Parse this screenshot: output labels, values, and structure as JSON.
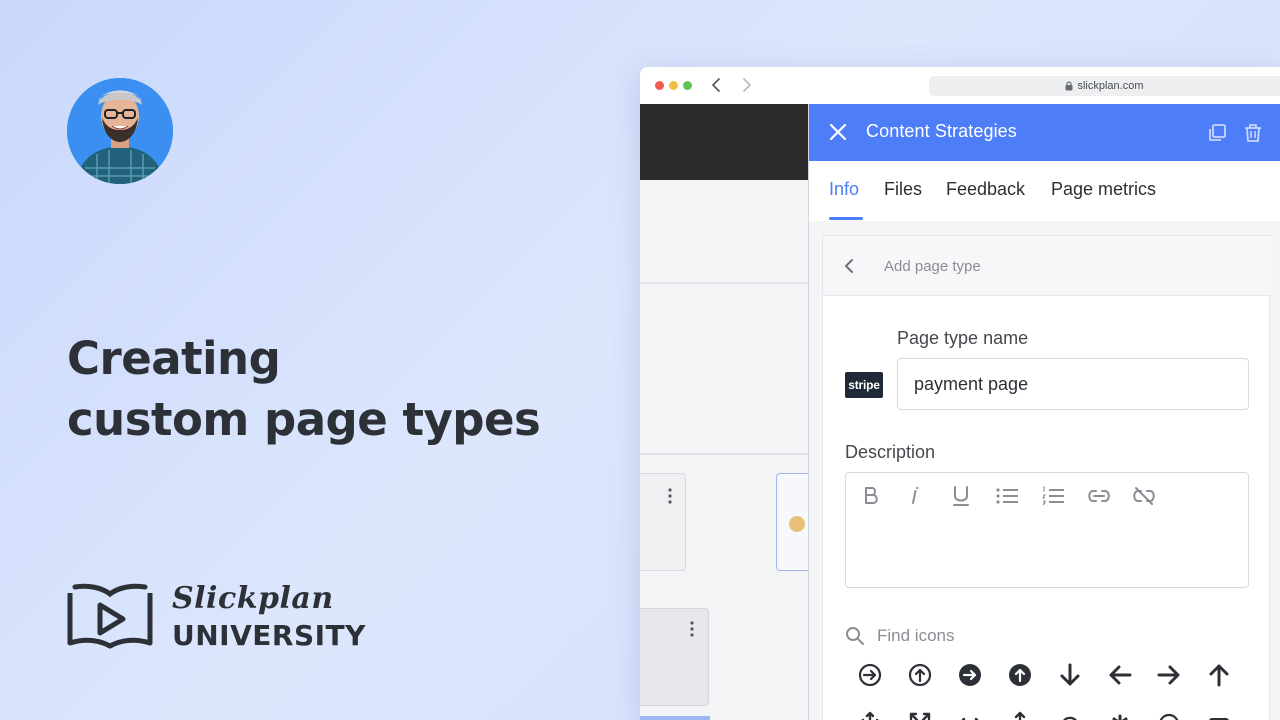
{
  "promo": {
    "headline_line1": "Creating",
    "headline_line2": "custom page types",
    "brand_script": "Slickplan",
    "brand_sub": "UNIVERSITY"
  },
  "browser": {
    "url": "slickplan.com"
  },
  "panel": {
    "title": "Content Strategies",
    "tabs": [
      {
        "label": "Info",
        "active": true
      },
      {
        "label": "Files",
        "active": false
      },
      {
        "label": "Feedback",
        "active": false
      },
      {
        "label": "Page metrics",
        "active": false
      }
    ],
    "back_label": "Add page type",
    "page_type_name_label": "Page type name",
    "page_type_icon_text": "stripe",
    "page_type_name_value": "payment page",
    "description_label": "Description",
    "toolbar": [
      "bold-icon",
      "italic-icon",
      "underline-icon",
      "bulleted-list-icon",
      "numbered-list-icon",
      "link-icon",
      "unlink-icon"
    ],
    "find_icons_placeholder": "Find icons",
    "icon_grid": [
      "circle-arrow-right-icon",
      "circle-arrow-up-icon",
      "circle-arrow-right-filled-icon",
      "circle-arrow-up-filled-icon",
      "arrow-down-icon",
      "arrow-left-icon",
      "arrow-right-icon",
      "arrow-up-icon"
    ]
  },
  "colors": {
    "accent": "#4d7ef7",
    "text_dark": "#2d3036",
    "background": "#d3e0fc"
  }
}
